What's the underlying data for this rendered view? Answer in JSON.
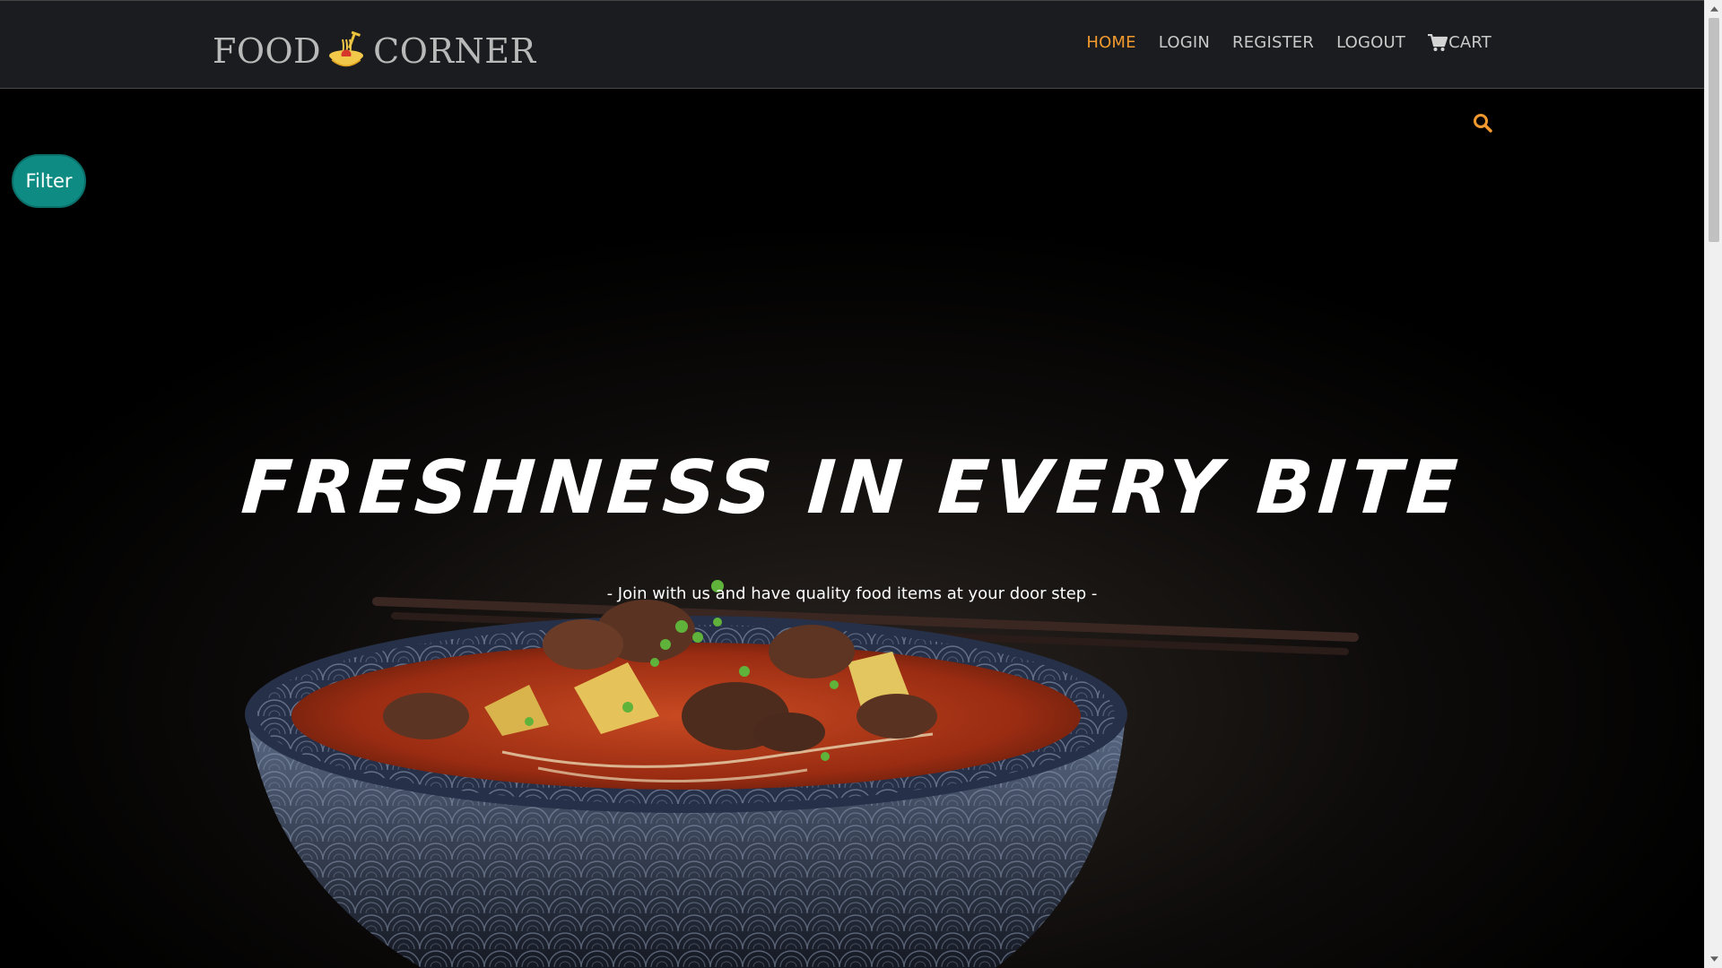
{
  "brand": {
    "name_left": "FOOD",
    "name_right": "CORNER",
    "logo_icon": "noodle-bowl-icon"
  },
  "nav": {
    "items": [
      {
        "label": "HOME",
        "active": true
      },
      {
        "label": "LOGIN",
        "active": false
      },
      {
        "label": "REGISTER",
        "active": false
      },
      {
        "label": "LOGOUT",
        "active": false
      }
    ],
    "cart": {
      "label": "CART",
      "icon": "cart-icon"
    }
  },
  "hero": {
    "title": "FRESHNESS IN EVERY BITE",
    "subtitle": "- Join with us and have quality food items at your door step -",
    "filter_label": "Filter",
    "search_icon": "search-icon",
    "background_image": "noodle-soup-bowl-photo"
  },
  "colors": {
    "navbar_bg": "#1b1c1f",
    "accent": "#f39a2f",
    "filter_bg": "#0e8c84",
    "nav_text": "#c9c9c9"
  }
}
